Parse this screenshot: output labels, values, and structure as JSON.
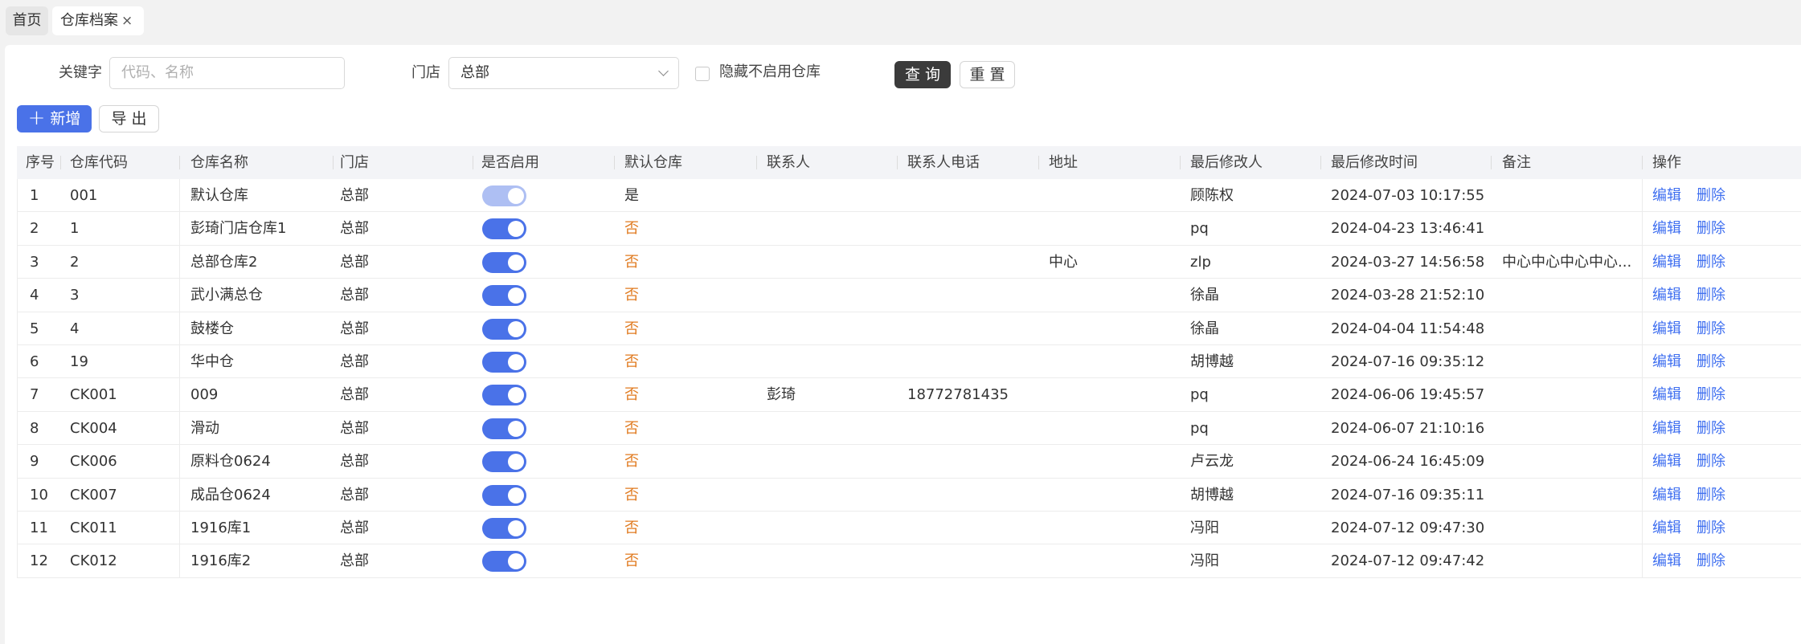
{
  "tabs": {
    "home": "首页",
    "active": "仓库档案",
    "close": "×"
  },
  "filters": {
    "keyword_label": "关键字",
    "keyword_placeholder": "代码、名称",
    "store_label": "门店",
    "store_value": "总部",
    "hide_disabled_label": "隐藏不启用仓库",
    "query_button": "查 询",
    "reset_button": "重 置"
  },
  "toolbar": {
    "add_icon": "+",
    "add_label": "新增",
    "export_label": "导 出"
  },
  "table": {
    "headers": [
      "序号",
      "仓库代码",
      "仓库名称",
      "门店",
      "是否启用",
      "默认仓库",
      "联系人",
      "联系人电话",
      "地址",
      "最后修改人",
      "最后修改时间",
      "备注",
      "操作"
    ],
    "actions": {
      "edit": "编辑",
      "delete": "删除"
    },
    "rows": [
      {
        "idx": "1",
        "code": "001",
        "name": "默认仓库",
        "store": "总部",
        "enabled": true,
        "enabled_disabled": true,
        "default": "是",
        "contact": "",
        "phone": "",
        "address": "",
        "modifier": "顾陈权",
        "modified": "2024-07-03 10:17:55",
        "remark": ""
      },
      {
        "idx": "2",
        "code": "1",
        "name": "彭琦门店仓库1",
        "store": "总部",
        "enabled": true,
        "default": "否",
        "contact": "",
        "phone": "",
        "address": "",
        "modifier": "pq",
        "modified": "2024-04-23 13:46:41",
        "remark": ""
      },
      {
        "idx": "3",
        "code": "2",
        "name": "总部仓库2",
        "store": "总部",
        "enabled": true,
        "default": "否",
        "contact": "",
        "phone": "",
        "address": "中心",
        "modifier": "zlp",
        "modified": "2024-03-27 14:56:58",
        "remark": "中心中心中心中心..."
      },
      {
        "idx": "4",
        "code": "3",
        "name": "武小满总仓",
        "store": "总部",
        "enabled": true,
        "default": "否",
        "contact": "",
        "phone": "",
        "address": "",
        "modifier": "徐晶",
        "modified": "2024-03-28 21:52:10",
        "remark": ""
      },
      {
        "idx": "5",
        "code": "4",
        "name": "鼓楼仓",
        "store": "总部",
        "enabled": true,
        "default": "否",
        "contact": "",
        "phone": "",
        "address": "",
        "modifier": "徐晶",
        "modified": "2024-04-04 11:54:48",
        "remark": ""
      },
      {
        "idx": "6",
        "code": "19",
        "name": "华中仓",
        "store": "总部",
        "enabled": true,
        "default": "否",
        "contact": "",
        "phone": "",
        "address": "",
        "modifier": "胡博越",
        "modified": "2024-07-16 09:35:12",
        "remark": ""
      },
      {
        "idx": "7",
        "code": "CK001",
        "name": "009",
        "store": "总部",
        "enabled": true,
        "default": "否",
        "contact": "彭琦",
        "phone": "18772781435",
        "address": "",
        "modifier": "pq",
        "modified": "2024-06-06 19:45:57",
        "remark": ""
      },
      {
        "idx": "8",
        "code": "CK004",
        "name": "滑动",
        "store": "总部",
        "enabled": true,
        "default": "否",
        "contact": "",
        "phone": "",
        "address": "",
        "modifier": "pq",
        "modified": "2024-06-07 21:10:16",
        "remark": ""
      },
      {
        "idx": "9",
        "code": "CK006",
        "name": "原料仓0624",
        "store": "总部",
        "enabled": true,
        "default": "否",
        "contact": "",
        "phone": "",
        "address": "",
        "modifier": "卢云龙",
        "modified": "2024-06-24 16:45:09",
        "remark": ""
      },
      {
        "idx": "10",
        "code": "CK007",
        "name": "成品仓0624",
        "store": "总部",
        "enabled": true,
        "default": "否",
        "contact": "",
        "phone": "",
        "address": "",
        "modifier": "胡博越",
        "modified": "2024-07-16 09:35:11",
        "remark": ""
      },
      {
        "idx": "11",
        "code": "CK011",
        "name": "1916库1",
        "store": "总部",
        "enabled": true,
        "default": "否",
        "contact": "",
        "phone": "",
        "address": "",
        "modifier": "冯阳",
        "modified": "2024-07-12 09:47:30",
        "remark": ""
      },
      {
        "idx": "12",
        "code": "CK012",
        "name": "1916库2",
        "store": "总部",
        "enabled": true,
        "default": "否",
        "contact": "",
        "phone": "",
        "address": "",
        "modifier": "冯阳",
        "modified": "2024-07-12 09:47:42",
        "remark": ""
      }
    ]
  },
  "colors": {
    "primary": "#4a72e8",
    "link": "#3f6ff0",
    "no_text": "#e07a1f",
    "dark_button": "#3b3b3b"
  }
}
